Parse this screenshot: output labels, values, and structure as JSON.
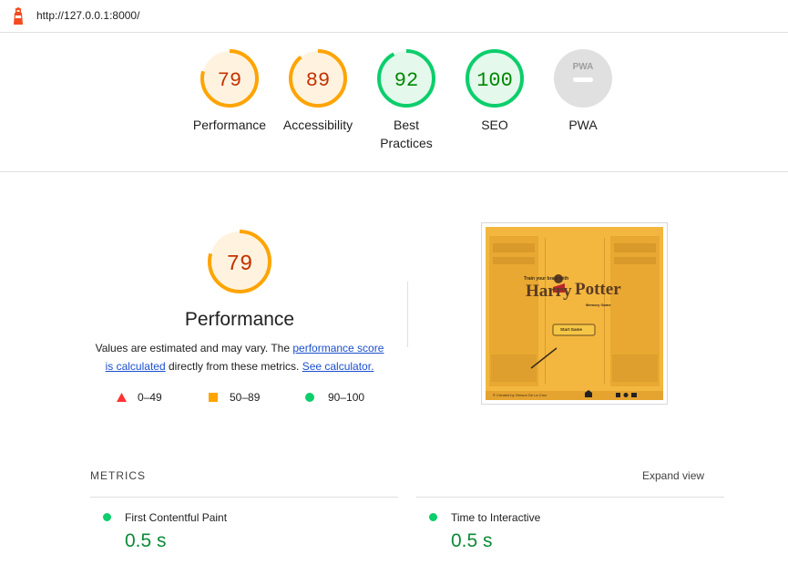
{
  "topbar": {
    "url": "http://127.0.0.1:8000/"
  },
  "gauges": [
    {
      "score": "79",
      "label": "Performance",
      "label2": "",
      "status": "average"
    },
    {
      "score": "89",
      "label": "Accessibility",
      "label2": "",
      "status": "average"
    },
    {
      "score": "92",
      "label": "Best",
      "label2": "Practices",
      "status": "pass"
    },
    {
      "score": "100",
      "label": "SEO",
      "label2": "",
      "status": "pass"
    },
    {
      "score": "",
      "label": "PWA",
      "label2": "",
      "status": "na",
      "badge": "PWA"
    }
  ],
  "performance": {
    "score": "79",
    "title": "Performance",
    "desc_pre": "Values are estimated and may vary. The ",
    "link1a": "performance score",
    "link1b": "is calculated",
    "desc_mid": " directly from these metrics. ",
    "link2": "See calculator.",
    "legend": [
      {
        "range": "0–49",
        "shape": "triangle",
        "color": "#ff3333"
      },
      {
        "range": "50–89",
        "shape": "square",
        "color": "#ffa400"
      },
      {
        "range": "90–100",
        "shape": "circle",
        "color": "#0cce6b"
      }
    ]
  },
  "screenshot": {
    "line1": "Train your brain with",
    "brand_a": "Harry",
    "brand_b": "Potter",
    "sub": "Memory Game",
    "button": "Start Game",
    "footer": "© Created by Gerson De La Cruz"
  },
  "metrics": {
    "heading": "METRICS",
    "expand": "Expand view",
    "items": [
      {
        "name": "First Contentful Paint",
        "value": "0.5 s"
      },
      {
        "name": "Time to Interactive",
        "value": "0.5 s"
      }
    ]
  },
  "colors": {
    "pass": "#0cce6b",
    "pass_text": "#008800",
    "average": "#ffa400",
    "average_text": "#c33300",
    "na": "#e0e0e0"
  }
}
